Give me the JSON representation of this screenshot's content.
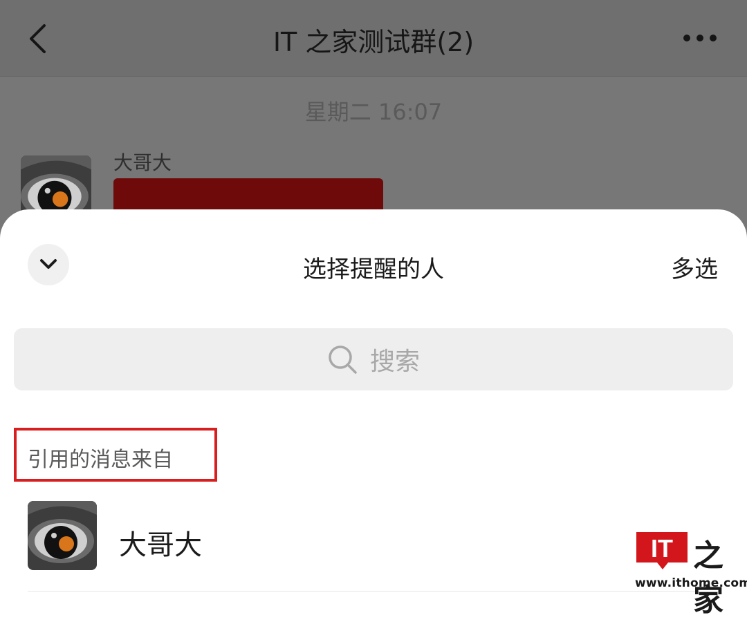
{
  "chat": {
    "title": "IT 之家测试群(2)",
    "timestamp": "星期二 16:07",
    "message": {
      "sender": "大哥大"
    }
  },
  "sheet": {
    "title": "选择提醒的人",
    "multi_select_label": "多选",
    "search": {
      "placeholder": "搜索"
    },
    "section_label": "引用的消息来自",
    "members": [
      {
        "name": "大哥大"
      }
    ]
  },
  "watermark": {
    "logo_text": "IT",
    "home_text": "之家",
    "url": "www.ithome.com"
  },
  "colors": {
    "overlay": "#777777",
    "sheet_bg": "#ffffff",
    "bubble": "#6e0a0a",
    "highlight_box": "#d81e1e",
    "brand_red": "#d2161b"
  },
  "icons": [
    "back-icon",
    "more-icon",
    "chevron-down-icon",
    "search-icon",
    "eye-avatar-icon"
  ]
}
